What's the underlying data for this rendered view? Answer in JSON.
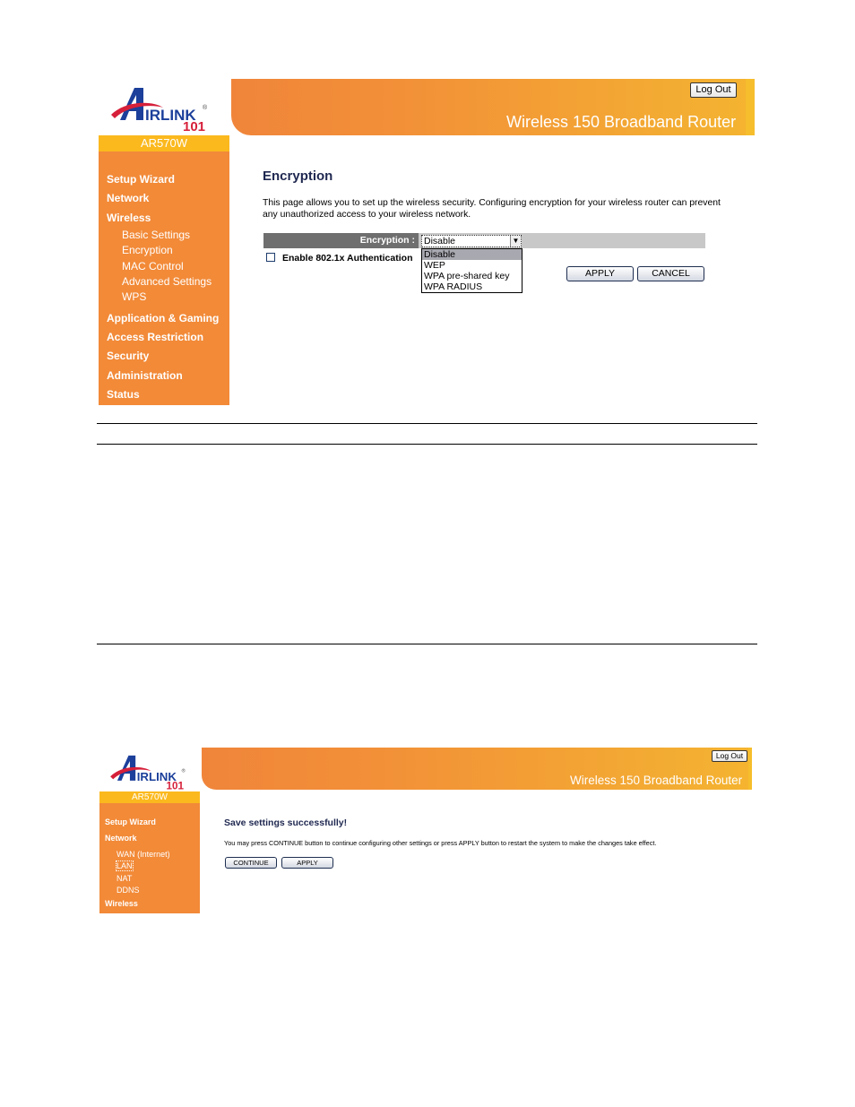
{
  "screens": [
    {
      "brand": {
        "logo_text": "AIRLINK",
        "logo_number": "101",
        "model": "AR570W"
      },
      "header": {
        "logout_label": "Log Out",
        "title": "Wireless 150 Broadband Router"
      },
      "sidebar": {
        "items": [
          {
            "label": "Setup Wizard"
          },
          {
            "label": "Network"
          },
          {
            "label": "Wireless",
            "children": [
              {
                "label": "Basic Settings"
              },
              {
                "label": "Encryption"
              },
              {
                "label": "MAC Control"
              },
              {
                "label": "Advanced Settings"
              },
              {
                "label": "WPS"
              }
            ]
          },
          {
            "label": "Application & Gaming"
          },
          {
            "label": "Access Restriction"
          },
          {
            "label": "Security"
          },
          {
            "label": "Administration"
          },
          {
            "label": "Status"
          }
        ]
      },
      "main": {
        "title": "Encryption",
        "description": "This page allows you to set up the wireless security. Configuring encryption for your wireless router can prevent any unauthorized access to your wireless network.",
        "encryption_label": "Encryption :",
        "encryption_value": "Disable",
        "encryption_options": [
          "Disable",
          "WEP",
          "WPA pre-shared key",
          "WPA RADIUS"
        ],
        "auth_checkbox_label": "Enable 802.1x Authentication",
        "auth_checked": false,
        "apply_label": "APPLY",
        "cancel_label": "CANCEL"
      }
    },
    {
      "brand": {
        "logo_text": "AIRLINK",
        "logo_number": "101",
        "model": "AR570W"
      },
      "header": {
        "logout_label": "Log Out",
        "title": "Wireless 150 Broadband Router"
      },
      "sidebar": {
        "items": [
          {
            "label": "Setup Wizard"
          },
          {
            "label": "Network",
            "children": [
              {
                "label": "WAN (Internet)"
              },
              {
                "label": "LAN"
              },
              {
                "label": "NAT"
              },
              {
                "label": "DDNS"
              }
            ]
          },
          {
            "label": "Wireless"
          }
        ]
      },
      "main": {
        "title": "Save settings successfully!",
        "description": "You may press CONTINUE button to continue configuring other settings or press APPLY button to restart the system to make the changes take effect.",
        "continue_label": "CONTINUE",
        "apply_label": "APPLY"
      }
    }
  ],
  "colors": {
    "sidebar_orange": "#f28a38",
    "model_bar_yellow": "#fbb91e",
    "title_navy": "#1f2850",
    "logo_blue": "#1b3f9a",
    "logo_red": "#d6203a"
  }
}
